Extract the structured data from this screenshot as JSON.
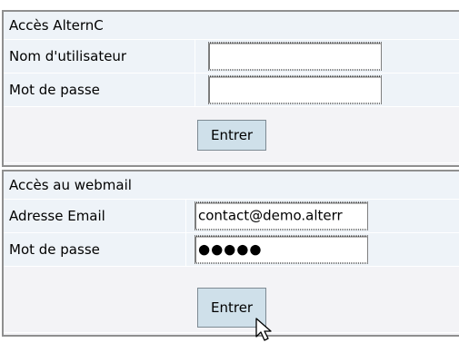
{
  "alternc": {
    "title": "Accès AlternC",
    "username_label": "Nom d'utilisateur",
    "username_value": "",
    "password_label": "Mot de passe",
    "password_value": "",
    "submit_label": "Entrer"
  },
  "webmail": {
    "title": "Accès au webmail",
    "email_label": "Adresse Email",
    "email_value": "contact@demo.alterr",
    "password_label": "Mot de passe",
    "password_value": "●●●●●",
    "submit_label": "Entrer"
  },
  "icons": {
    "cursor": "mouse-pointer-icon"
  }
}
